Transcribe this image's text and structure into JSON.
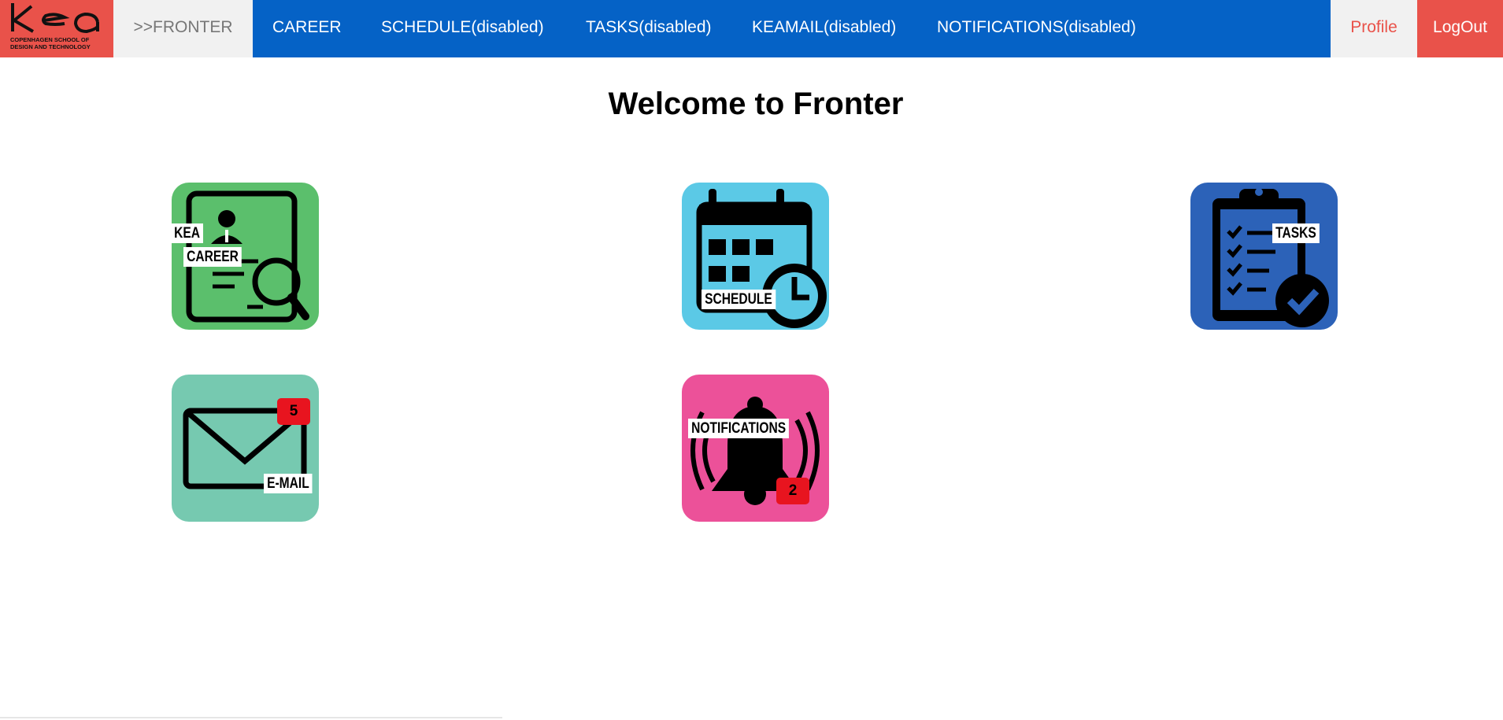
{
  "brand": {
    "logo_text": "KEA",
    "logo_subtext": "COPENHAGEN SCHOOL OF DESIGN AND TECHNOLOGY",
    "accent_color": "#e9524a"
  },
  "nav": {
    "background": "#0562c6",
    "links": [
      {
        "label": ">>FRONTER",
        "state": "active"
      },
      {
        "label": "CAREER"
      },
      {
        "label": "SCHEDULE(disabled)"
      },
      {
        "label": "TASKS(disabled)"
      },
      {
        "label": "KEAMAIL(disabled)"
      },
      {
        "label": "NOTIFICATIONS(disabled)"
      }
    ],
    "profile": "Profile",
    "logout": "LogOut"
  },
  "main": {
    "title": "Welcome to Fronter",
    "tiles": [
      {
        "icon": "career-search-icon",
        "color": "#5bbf6c",
        "labels": [
          "KEA",
          "CAREER"
        ]
      },
      {
        "icon": "calendar-clock-icon",
        "color": "#5bc9e6",
        "labels": [
          "SCHEDULE"
        ]
      },
      {
        "icon": "clipboard-check-icon",
        "color": "#2c62b8",
        "labels": [
          "TASKS"
        ]
      },
      {
        "icon": "envelope-icon",
        "color": "#76c9b0",
        "labels": [
          "E-MAIL"
        ],
        "badge": "5"
      },
      {
        "icon": "bell-icon",
        "color": "#ec5199",
        "labels": [
          "NOTIFICATIONS"
        ],
        "badge": "2"
      }
    ]
  }
}
